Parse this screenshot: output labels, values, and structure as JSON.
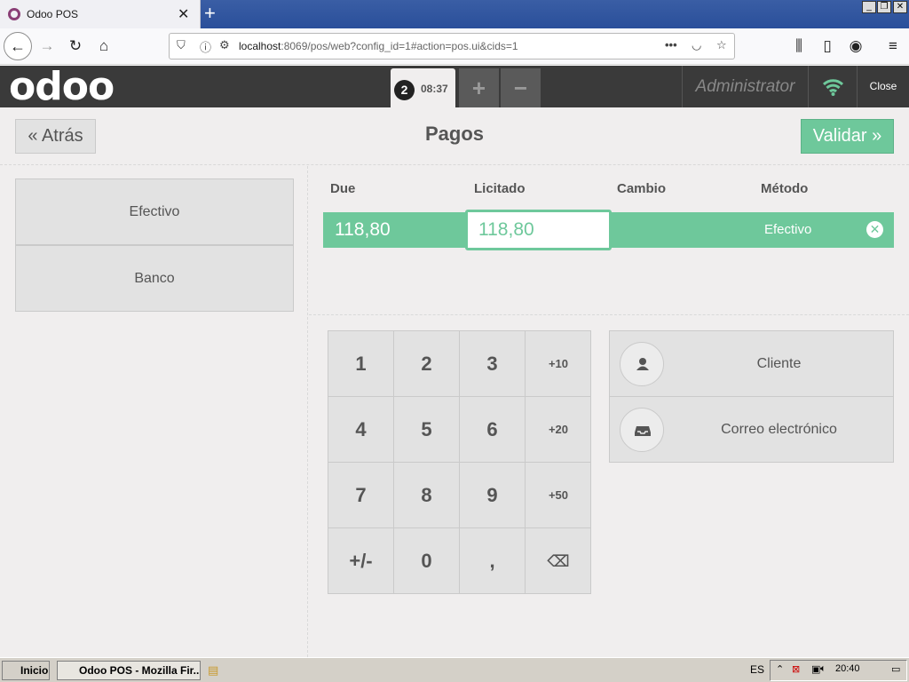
{
  "browser": {
    "tab_title": "Odoo POS",
    "url_host": "localhost",
    "url_rest": ":8069/pos/web?config_id=1#action=pos.ui&cids=1"
  },
  "header": {
    "logo": "odoo",
    "order_number": "2",
    "order_time": "08:37",
    "add_label": "+",
    "remove_label": "−",
    "user": "Administrator",
    "close_label": "Close"
  },
  "payment": {
    "back_label": "Atrás",
    "title": "Pagos",
    "validate_label": "Validar",
    "methods": [
      "Efectivo",
      "Banco"
    ],
    "columns": {
      "due": "Due",
      "tendered": "Licitado",
      "change": "Cambio",
      "method": "Método"
    },
    "line": {
      "due": "118,80",
      "tendered": "118,80",
      "method": "Efectivo"
    }
  },
  "numpad": {
    "keys": [
      "1",
      "2",
      "3",
      "+10",
      "4",
      "5",
      "6",
      "+20",
      "7",
      "8",
      "9",
      "+50",
      "+/-",
      "0",
      ",",
      "⌫"
    ]
  },
  "client": {
    "customer_label": "Cliente",
    "email_label": "Correo electrónico"
  },
  "taskbar": {
    "start_label": "Inicio",
    "task_label": "Odoo POS - Mozilla Fir...",
    "lang": "ES",
    "clock": "20:40"
  },
  "colors": {
    "accent": "#6ec89b",
    "header": "#3a3a3a",
    "odoo_purple": "#8a3f76"
  }
}
